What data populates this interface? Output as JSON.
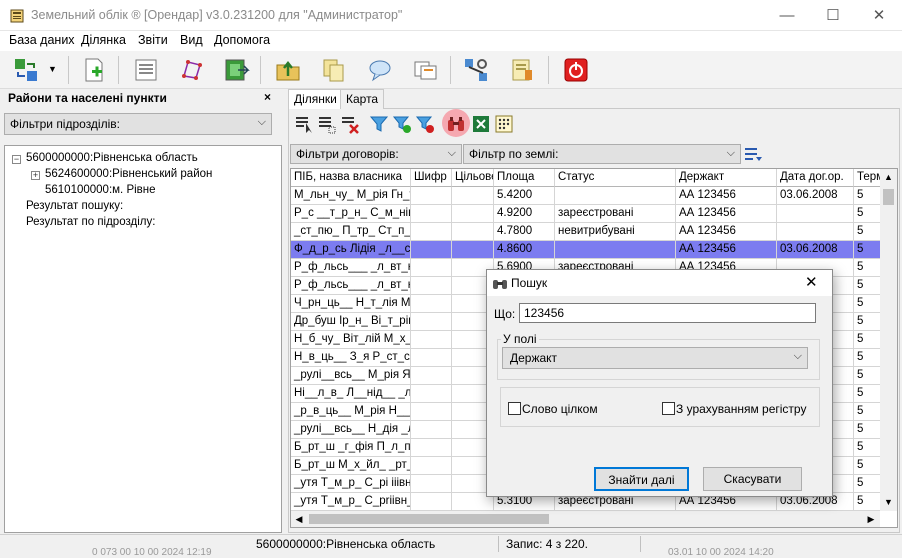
{
  "window": {
    "title": "Земельний облік ® [Орендар] v3.0.231200 для \"Администратор\"",
    "minimize": "—",
    "maximize": "☐",
    "close": "✕"
  },
  "menu": [
    "База даних",
    "Ділянка",
    "Звіти",
    "Вид",
    "Допомога"
  ],
  "left_panel": {
    "title": "Райони та населені пункти",
    "close": "×",
    "filter": "Фільтри підрозділів:",
    "tree": [
      {
        "label": "5600000000:Рівненська область",
        "expander": "−"
      },
      {
        "label": "5624600000:Рівненський район",
        "expander": "+"
      },
      {
        "label": "5610100000:м. Рівне",
        "expander": ""
      },
      {
        "label": "Результат пошуку:",
        "expander": ""
      },
      {
        "label": "Результат по підрозділу:",
        "expander": ""
      }
    ]
  },
  "tabs": [
    "Ділянки",
    "Карта"
  ],
  "filters": {
    "contracts": "Фільтри договорів:",
    "land": "Фільтр по землі:"
  },
  "grid": {
    "columns": [
      "ПІБ, назва власника",
      "Шифр",
      "Цільове",
      "Площа",
      "Статус",
      "Державний акт",
      "Дата дог.ор.",
      "Термін"
    ],
    "column_display": [
      "ПІБ, назва власника",
      "Шифр",
      "Цільове",
      "Площа",
      "Статус",
      "Держакт",
      "Дата дог.ор.",
      "Терм"
    ],
    "rows": [
      [
        "М_льн_чу_ М_рія Гн_тівна",
        "",
        "",
        "5.4200",
        "",
        "АА 123456",
        "03.06.2008",
        "5"
      ],
      [
        "Р_с __т_р_н_ С_м_нівна",
        "",
        "",
        "4.9200",
        "зареєстровані",
        "АА 123456",
        "",
        "5"
      ],
      [
        "_ст_пю_ П_тр_ Ст_п_нович",
        "",
        "",
        "4.7800",
        "невитрибувані",
        "АА 123456",
        "",
        "5"
      ],
      [
        "Ф_д_р_сь Лідія _л__с_нд",
        "",
        "",
        "4.8600",
        "",
        "АА 123456",
        "03.06.2008",
        "5"
      ],
      [
        "Р_ф_льсь___ _л_вт_н_ Б",
        "",
        "",
        "5.6900",
        "зареєстровані",
        "АА 123456",
        "",
        "5"
      ],
      [
        "Р_ф_льсь___ _л_вт_н_ Б",
        "",
        "",
        "",
        "",
        "",
        "",
        "5"
      ],
      [
        "Ч_рн_ць__ Н_т_лія М___",
        "",
        "",
        "",
        "",
        "",
        "",
        "5"
      ],
      [
        "Др_буш Ір_н_ Ві_т_рівна",
        "",
        "",
        "",
        "",
        "",
        "",
        "5"
      ],
      [
        "Н_б_чу_ Віт_лій М_х_йл",
        "",
        "",
        "",
        "",
        "",
        "",
        "5"
      ],
      [
        "Н_в_ць__ З_я Р_ст_сл_",
        "",
        "",
        "",
        "",
        "",
        "",
        "5"
      ],
      [
        "_рулі__всь__ М_рія Я___",
        "",
        "",
        "",
        "",
        "",
        "",
        "5"
      ],
      [
        "Ні__л_в_ Л__нід__ _л__",
        "",
        "",
        "",
        "",
        "",
        "",
        "5"
      ],
      [
        "_р_в_ць__ М_рія Н___ф",
        "",
        "",
        "",
        "",
        "",
        "",
        "5"
      ],
      [
        "_рулі__всь__ Н_дія _л_",
        "",
        "",
        "",
        "",
        "",
        "",
        "5"
      ],
      [
        "Б_рт_ш _г_фія П_л_півна",
        "",
        "",
        "",
        "",
        "",
        "",
        "5"
      ],
      [
        "Б_рт_ш М_х_йл_ _рт_м",
        "",
        "",
        "",
        "",
        "",
        "",
        "5"
      ],
      [
        "_утя Т_м_р_ С_рі ііівн_",
        "",
        "",
        "",
        "",
        "",
        "",
        "5"
      ],
      [
        "_утя Т_м_р_ С_рrіівн_",
        "",
        "",
        "5.3100",
        "зареєстровані",
        "АА 123456",
        "03.06.2008",
        "5"
      ]
    ],
    "selected_row": 3
  },
  "status": {
    "left": "0 073 00 10 00 2024 12:19",
    "region": "5600000000:Рівненська область",
    "record": "Запис: 4  з 220.",
    "right": "03.01 10 00 2024 14:20"
  },
  "dialog": {
    "title": "Пошук",
    "close": "✕",
    "what_label": "Що:",
    "what_value": "123456",
    "field_group": "У полі",
    "field_value": "Держакт",
    "whole_word": "Слово цілком",
    "case_sensitive": "З урахуванням регістру",
    "find_next": "Знайти далі",
    "cancel": "Скасувати"
  },
  "colors": {
    "selection": "#7c7cf0",
    "highlight_button": "#f5a8b0",
    "accent": "#0078d7"
  }
}
